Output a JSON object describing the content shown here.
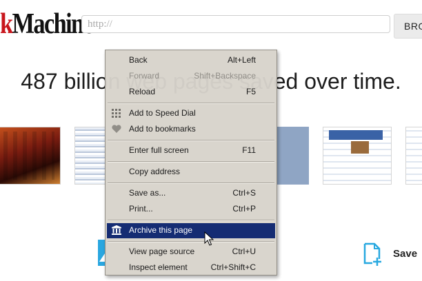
{
  "header": {
    "logo_prefix": "k",
    "logo_main": "Machine",
    "url_placeholder": "http://",
    "browse_button": "BRO"
  },
  "headline": "487 billion web pages saved over time.",
  "footer": {
    "save_label": "Save"
  },
  "colors": {
    "menu_bg": "#d8d4cc",
    "highlight": "#0c246e",
    "logo_red": "#c8151b",
    "accent_blue": "#2aa7e0"
  },
  "context_menu": {
    "items": [
      {
        "label": "Back",
        "shortcut": "Alt+Left"
      },
      {
        "label": "Forward",
        "shortcut": "Shift+Backspace",
        "disabled": true
      },
      {
        "label": "Reload",
        "shortcut": "F5"
      },
      {
        "label": "Add to Speed Dial",
        "shortcut": "",
        "icon": "speed-dial-icon"
      },
      {
        "label": "Add to bookmarks",
        "shortcut": "",
        "icon": "heart-icon"
      },
      {
        "label": "Enter full screen",
        "shortcut": "F11"
      },
      {
        "label": "Copy address",
        "shortcut": ""
      },
      {
        "label": "Save as...",
        "shortcut": "Ctrl+S"
      },
      {
        "label": "Print...",
        "shortcut": "Ctrl+P"
      },
      {
        "label": "Archive this page",
        "shortcut": "",
        "icon": "archive-icon",
        "highlighted": true
      },
      {
        "label": "View page source",
        "shortcut": "Ctrl+U"
      },
      {
        "label": "Inspect element",
        "shortcut": "Ctrl+Shift+C"
      }
    ]
  }
}
